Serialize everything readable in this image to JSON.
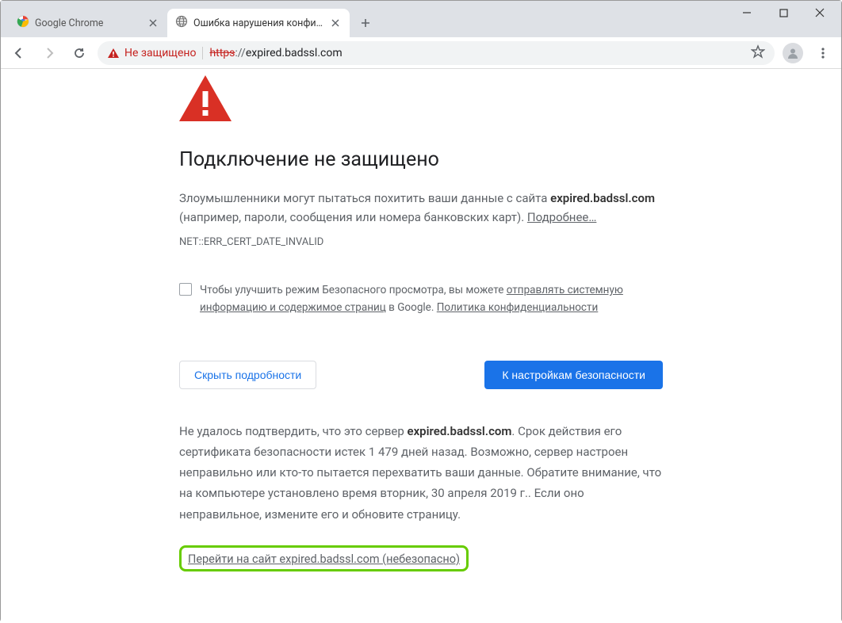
{
  "tabs": [
    {
      "title": "Google Chrome"
    },
    {
      "title": "Ошибка нарушения конфиденц"
    }
  ],
  "security_label": "Не защищено",
  "url_https": "https",
  "url_sep": "://",
  "url_domain": "expired.badssl.com",
  "page": {
    "heading": "Подключение не защищено",
    "para1_a": "Злоумышленники могут пытаться похитить ваши данные с сайта ",
    "para1_domain": "expired.badssl.com",
    "para1_b": " (например, пароли, сообщения или номера банковских карт). ",
    "learn_more": "Подробнее…",
    "error_code": "NET::ERR_CERT_DATE_INVALID",
    "optin_a": "Чтобы улучшить режим Безопасного просмотра, вы можете ",
    "optin_link1": "отправлять системную информацию и содержимое страниц",
    "optin_b": " в Google. ",
    "optin_link2": "Политика конфиденциальности",
    "btn_hide": "Скрыть подробности",
    "btn_safety": "К настройкам безопасности",
    "details_a": "Не удалось подтвердить, что это сервер ",
    "details_domain": "expired.badssl.com",
    "details_b": ". Срок действия его сертификата безопасности истек 1 479 дней назад. Возможно, сервер настроен неправильно или кто-то пытается перехватить ваши данные. Обратите внимание, что на компьютере установлено время вторник, 30 апреля 2019 г.. Если оно неправильное, измените его и обновите страницу.",
    "proceed": "Перейти на сайт expired.badssl.com (небезопасно)"
  }
}
